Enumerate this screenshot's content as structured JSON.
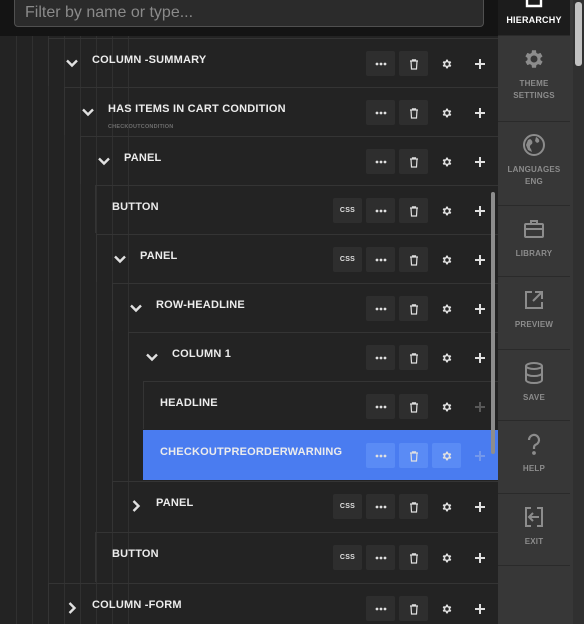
{
  "filter": {
    "placeholder": "Filter by name or type..."
  },
  "actions": {
    "css_label": "CSS",
    "icons": [
      "more-icon",
      "trash-icon",
      "gear-icon",
      "plus-icon"
    ]
  },
  "colors": {
    "selected_row": "#4a7cf0",
    "sidebar_bg": "#373737",
    "panel_bg": "#232323"
  },
  "tree": {
    "rows": [
      {
        "label": "COLUMN -SUMMARY",
        "expander": "expanded",
        "css": false
      },
      {
        "label": "HAS ITEMS IN CART CONDITION",
        "sublabel": "CHECKOUTCONDITION",
        "expander": "expanded",
        "css": false
      },
      {
        "label": "PANEL",
        "expander": "expanded",
        "css": false
      },
      {
        "label": "BUTTON",
        "expander": "none",
        "css": true
      },
      {
        "label": "PANEL",
        "expander": "expanded",
        "css": true
      },
      {
        "label": "ROW-HEADLINE",
        "expander": "expanded",
        "css": false
      },
      {
        "label": "COLUMN 1",
        "expander": "expanded",
        "css": false
      },
      {
        "label": "HEADLINE",
        "expander": "none",
        "css": false,
        "add_disabled": true
      },
      {
        "label": "CHECKOUTPREORDERWARNING",
        "expander": "none",
        "css": false,
        "selected": true,
        "add_disabled": true
      },
      {
        "label": "PANEL",
        "expander": "collapsed",
        "css": true
      },
      {
        "label": "BUTTON",
        "expander": "none",
        "css": true
      },
      {
        "label": "COLUMN -FORM",
        "expander": "collapsed",
        "css": false
      }
    ]
  },
  "sidebar": {
    "items": [
      {
        "label": "HIERARCHY",
        "icon": "hierarchy-icon",
        "active": true
      },
      {
        "label": "THEME\nSETTINGS",
        "icon": "gear-icon"
      },
      {
        "label": "LANGUAGES\nENG",
        "icon": "globe-icon"
      },
      {
        "label": "LIBRARY",
        "icon": "briefcase-icon"
      },
      {
        "label": "PREVIEW",
        "icon": "external-link-icon"
      },
      {
        "label": "SAVE",
        "icon": "database-icon"
      },
      {
        "label": "HELP",
        "icon": "question-icon"
      },
      {
        "label": "EXIT",
        "icon": "exit-icon"
      }
    ]
  }
}
